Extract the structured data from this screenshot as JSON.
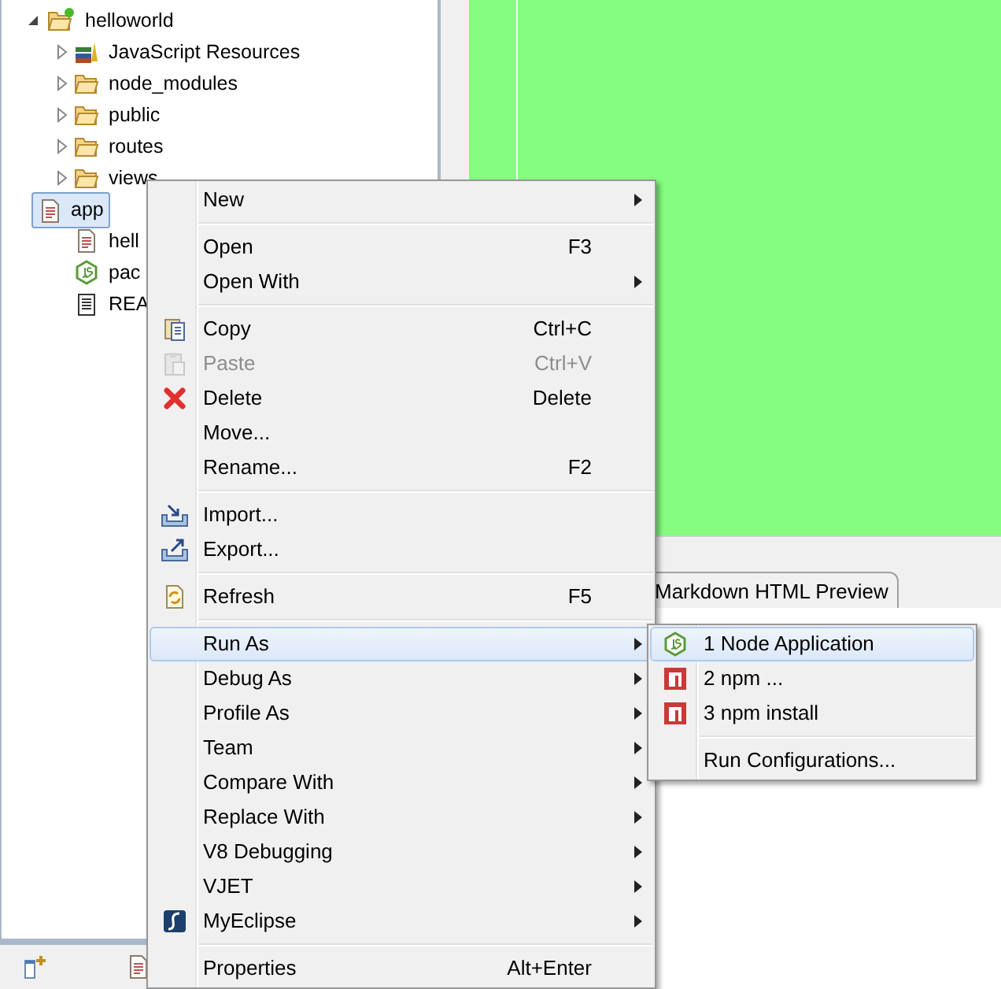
{
  "tree": {
    "label": "helloworld",
    "expanded": true,
    "children": [
      {
        "label": "JavaScript Resources",
        "kind": "library",
        "expanded": false,
        "selected": false
      },
      {
        "label": "node_modules",
        "kind": "folder",
        "expanded": false,
        "selected": false
      },
      {
        "label": "public",
        "kind": "folder",
        "expanded": false,
        "selected": false
      },
      {
        "label": "routes",
        "kind": "folder",
        "expanded": false,
        "selected": false
      },
      {
        "label": "views",
        "kind": "folder",
        "expanded": false,
        "selected": false
      },
      {
        "label": "app",
        "kind": "file",
        "selected": true
      },
      {
        "label": "hell",
        "kind": "file",
        "selected": false
      },
      {
        "label": "pac",
        "kind": "json",
        "selected": false
      },
      {
        "label": "REA",
        "kind": "text",
        "selected": false
      }
    ]
  },
  "editor_tab": {
    "label": "Markdown HTML Preview"
  },
  "context_menu": [
    {
      "kind": "item",
      "label": "New",
      "submenu": true,
      "selected": false,
      "disabled": false
    },
    {
      "kind": "separator"
    },
    {
      "kind": "item",
      "label": "Open",
      "shortcut": "F3",
      "selected": false,
      "disabled": false
    },
    {
      "kind": "item",
      "label": "Open With",
      "submenu": true,
      "selected": false,
      "disabled": false
    },
    {
      "kind": "separator"
    },
    {
      "kind": "item",
      "label": "Copy",
      "shortcut": "Ctrl+C",
      "selected": false,
      "disabled": false
    },
    {
      "kind": "item",
      "label": "Paste",
      "shortcut": "Ctrl+V",
      "selected": false,
      "disabled": true
    },
    {
      "kind": "item",
      "label": "Delete",
      "shortcut": "Delete",
      "selected": false,
      "disabled": false
    },
    {
      "kind": "item",
      "label": "Move...",
      "selected": false,
      "disabled": false
    },
    {
      "kind": "item",
      "label": "Rename...",
      "shortcut": "F2",
      "selected": false,
      "disabled": false
    },
    {
      "kind": "separator"
    },
    {
      "kind": "item",
      "label": "Import...",
      "selected": false,
      "disabled": false
    },
    {
      "kind": "item",
      "label": "Export...",
      "selected": false,
      "disabled": false
    },
    {
      "kind": "separator"
    },
    {
      "kind": "item",
      "label": "Refresh",
      "shortcut": "F5",
      "selected": false,
      "disabled": false
    },
    {
      "kind": "separator"
    },
    {
      "kind": "item",
      "label": "Run As",
      "submenu": true,
      "selected": true,
      "disabled": false
    },
    {
      "kind": "item",
      "label": "Debug As",
      "submenu": true,
      "selected": false,
      "disabled": false
    },
    {
      "kind": "item",
      "label": "Profile As",
      "submenu": true,
      "selected": false,
      "disabled": false
    },
    {
      "kind": "item",
      "label": "Team",
      "submenu": true,
      "selected": false,
      "disabled": false
    },
    {
      "kind": "item",
      "label": "Compare With",
      "submenu": true,
      "selected": false,
      "disabled": false
    },
    {
      "kind": "item",
      "label": "Replace With",
      "submenu": true,
      "selected": false,
      "disabled": false
    },
    {
      "kind": "item",
      "label": "V8 Debugging",
      "submenu": true,
      "selected": false,
      "disabled": false
    },
    {
      "kind": "item",
      "label": "VJET",
      "submenu": true,
      "selected": false,
      "disabled": false
    },
    {
      "kind": "item",
      "label": "MyEclipse",
      "submenu": true,
      "selected": false,
      "disabled": false
    },
    {
      "kind": "separator"
    },
    {
      "kind": "item",
      "label": "Properties",
      "shortcut": "Alt+Enter",
      "selected": false,
      "disabled": false
    }
  ],
  "run_as_submenu": [
    {
      "kind": "item",
      "label": "1 Node Application",
      "selected": true
    },
    {
      "kind": "item",
      "label": "2 npm ...",
      "selected": false
    },
    {
      "kind": "item",
      "label": "3 npm install",
      "selected": false
    },
    {
      "kind": "separator"
    },
    {
      "kind": "item",
      "label": "Run Configurations...",
      "selected": false
    }
  ]
}
